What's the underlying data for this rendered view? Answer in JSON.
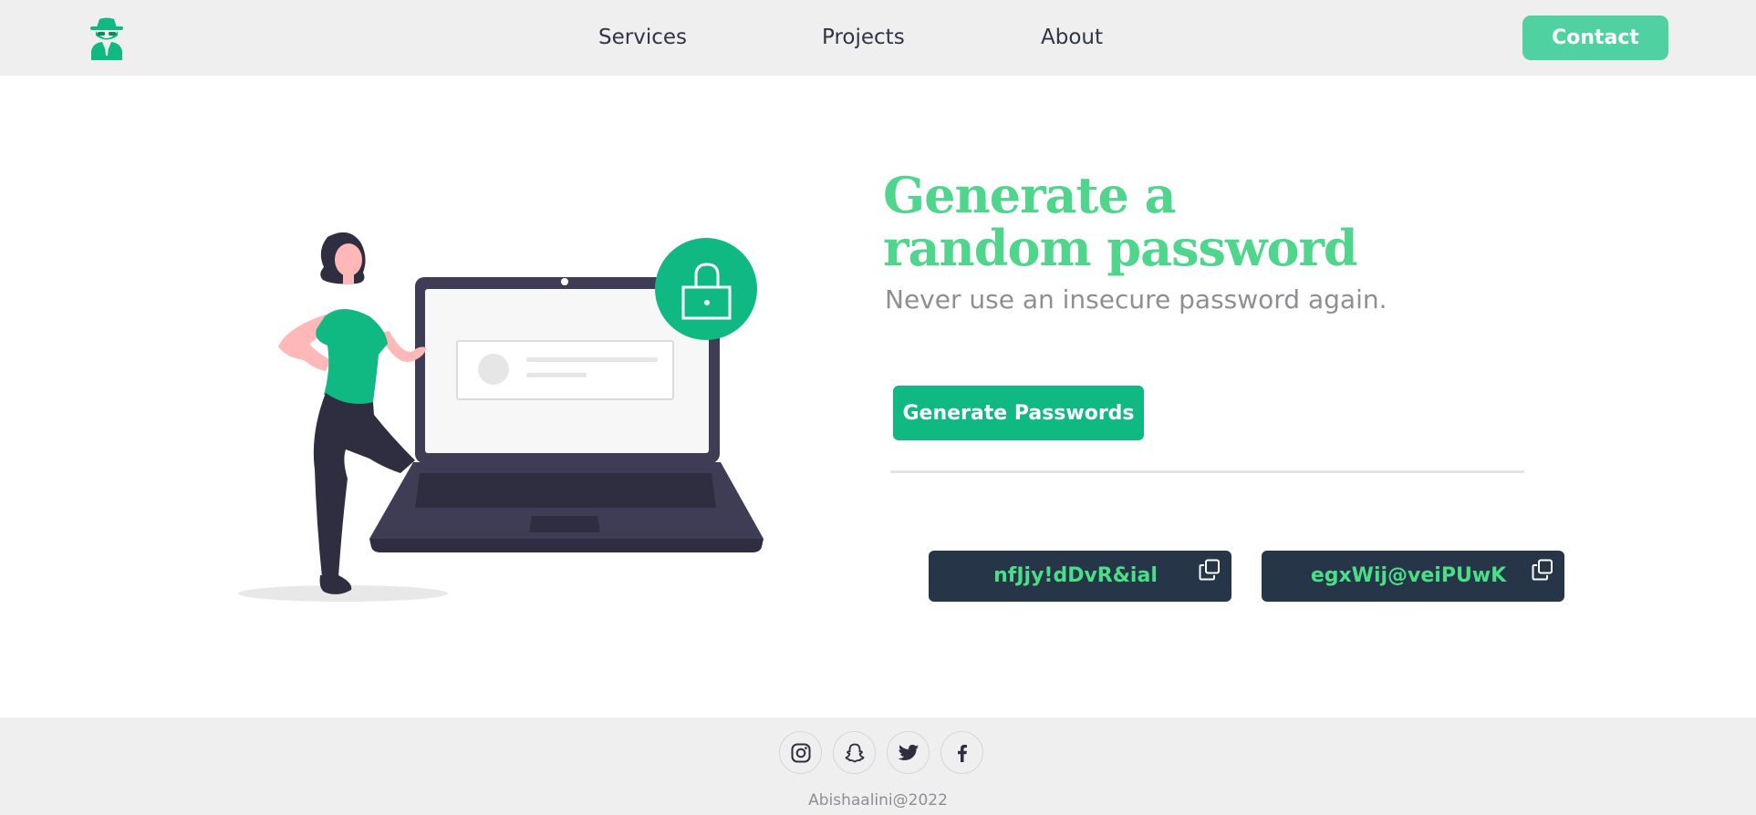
{
  "nav": {
    "logo_icon": "spy-logo-icon",
    "links": [
      "Services",
      "Projects",
      "About"
    ],
    "contact_label": "Contact"
  },
  "hero": {
    "title_line1": "Generate a",
    "title_line2": "random password",
    "subtitle": "Never use an insecure password again.",
    "generate_label": "Generate Passwords",
    "illustration_icon": "lock-icon"
  },
  "passwords": [
    {
      "value": "nfJjy!dDvR&ial",
      "icon": "copy-icon"
    },
    {
      "value": "egxWij@veiPUwK",
      "icon": "copy-icon"
    }
  ],
  "footer": {
    "social": [
      "instagram-icon",
      "snapchat-icon",
      "twitter-icon",
      "facebook-icon"
    ],
    "copyright": "Abishaalini@2022"
  },
  "colors": {
    "accent": "#10b981",
    "accent_light": "#4fd1a1",
    "title_green": "#4fd68c",
    "password_bg": "#273549",
    "password_text": "#4adf86",
    "nav_bg": "#f0eff0"
  }
}
